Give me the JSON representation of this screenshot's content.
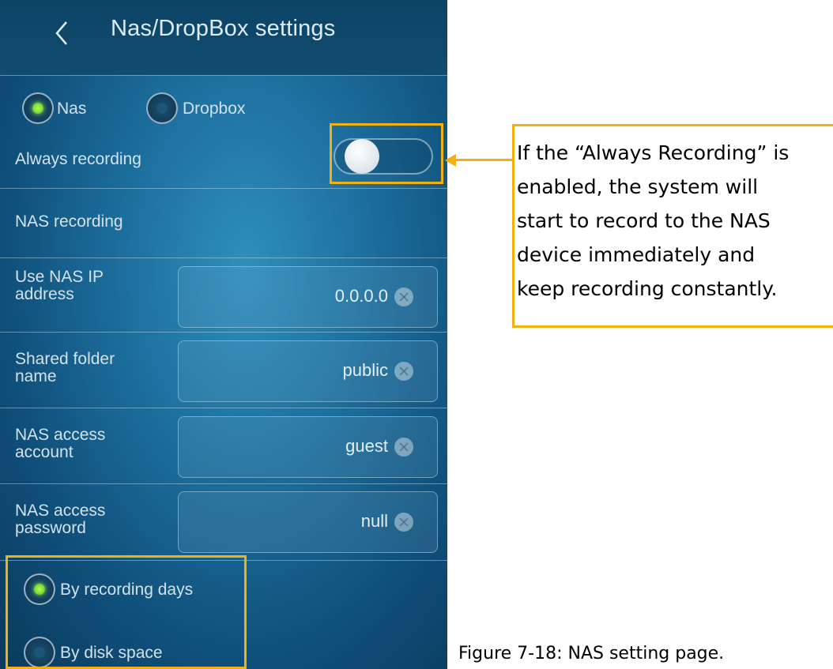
{
  "screen": {
    "title": "Nas/DropBox settings",
    "storage_options": [
      {
        "label": "Nas",
        "selected": true
      },
      {
        "label": "Dropbox",
        "selected": false
      }
    ],
    "always_recording": {
      "label": "Always recording",
      "enabled": false
    },
    "section_label": "NAS recording",
    "fields": [
      {
        "label_line1": "Use NAS IP",
        "label_line2": "address",
        "value": "0.0.0.0"
      },
      {
        "label_line1": "Shared folder",
        "label_line2": "name",
        "value": "public"
      },
      {
        "label_line1": "NAS access",
        "label_line2": "account",
        "value": "guest"
      },
      {
        "label_line1": "NAS access",
        "label_line2": "password",
        "value": "null"
      }
    ],
    "retention_options": [
      {
        "label": "By recording days",
        "selected": true
      },
      {
        "label": "By disk space",
        "selected": false
      }
    ]
  },
  "annotation": {
    "callout_text": "If the “Always Recording” is enabled, the system will start to record to the NAS device immediately and keep recording constantly.",
    "callout_lines": [
      "If the “Always Recording” is",
      "enabled, the system will",
      "start to record to the NAS",
      "device immediately and",
      "keep recording constantly."
    ],
    "highlight_color": "#f2b10e"
  },
  "caption": "Figure 7-18: NAS setting page."
}
